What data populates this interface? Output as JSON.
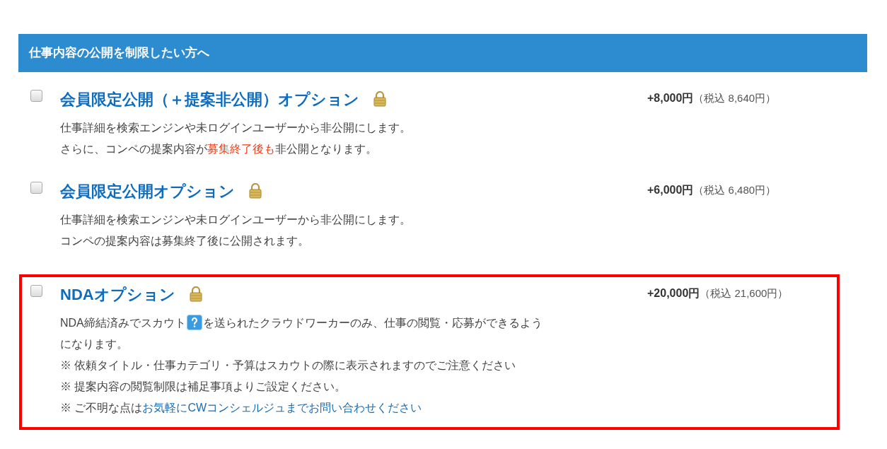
{
  "section": {
    "title": "仕事内容の公開を制限したい方へ"
  },
  "options": [
    {
      "title": "会員限定公開（＋提案非公開）オプション",
      "checked": false,
      "highlighted": false,
      "price": "+8,000円",
      "tax_note": "（税込 8,640円）",
      "lines": [
        [
          {
            "kind": "text",
            "text": "仕事詳細を検索エンジンや未ログインユーザーから非公開にします。"
          }
        ],
        [
          {
            "kind": "text",
            "text": "さらに、コンペの提案内容が"
          },
          {
            "kind": "emphasis",
            "text": "募集終了後も"
          },
          {
            "kind": "text",
            "text": "非公開となります。"
          }
        ]
      ]
    },
    {
      "title": "会員限定公開オプション",
      "checked": false,
      "highlighted": false,
      "price": "+6,000円",
      "tax_note": "（税込 6,480円）",
      "lines": [
        [
          {
            "kind": "text",
            "text": "仕事詳細を検索エンジンや未ログインユーザーから非公開にします。"
          }
        ],
        [
          {
            "kind": "text",
            "text": "コンペの提案内容は募集終了後に公開されます。"
          }
        ]
      ]
    },
    {
      "title": "NDAオプション",
      "checked": false,
      "highlighted": true,
      "price": "+20,000円",
      "tax_note": "（税込 21,600円）",
      "lines": [
        [
          {
            "kind": "text",
            "text": "NDA締結済みでスカウト"
          },
          {
            "kind": "help_icon"
          },
          {
            "kind": "text",
            "text": "を送られたクラウドワーカーのみ、仕事の閲覧・応募ができるよう"
          }
        ],
        [
          {
            "kind": "text",
            "text": "になります。"
          }
        ],
        [
          {
            "kind": "text",
            "text": "※ 依頼タイトル・仕事カテゴリ・予算はスカウトの際に表示されますのでご注意ください"
          }
        ],
        [
          {
            "kind": "text",
            "text": "※ 提案内容の閲覧制限は補足事項よりご設定ください。"
          }
        ],
        [
          {
            "kind": "text",
            "text": "※ ご不明な点は"
          },
          {
            "kind": "link",
            "text": "お気軽にCWコンシェルジュまでお問い合わせください"
          }
        ]
      ]
    }
  ]
}
